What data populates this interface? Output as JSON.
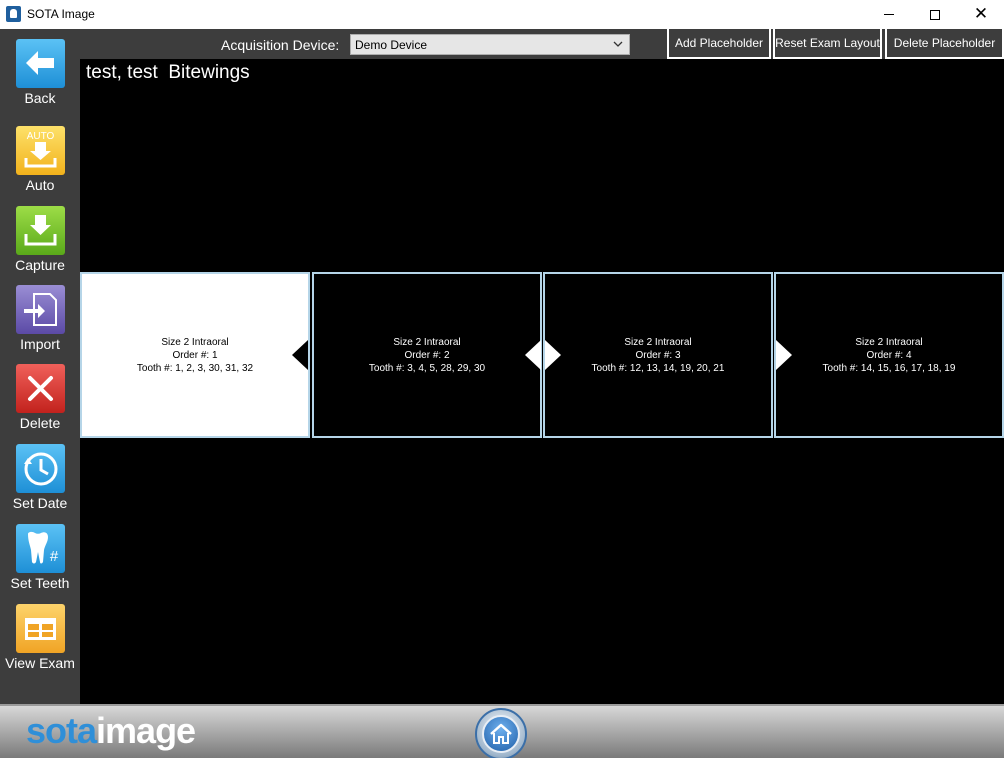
{
  "window": {
    "title": "SOTA Image",
    "icon": "sota-tooth-icon"
  },
  "sidebar": {
    "items": [
      {
        "label": "Back",
        "icon": "back-arrow-icon"
      },
      {
        "label": "Auto",
        "icon": "auto-download-icon",
        "badge": "AUTO"
      },
      {
        "label": "Capture",
        "icon": "capture-download-icon"
      },
      {
        "label": "Import",
        "icon": "import-icon"
      },
      {
        "label": "Delete",
        "icon": "delete-x-icon"
      },
      {
        "label": "Set Date",
        "icon": "clock-icon"
      },
      {
        "label": "Set Teeth",
        "icon": "tooth-number-icon",
        "badge": "#"
      },
      {
        "label": "View Exam",
        "icon": "view-exam-grid-icon"
      }
    ]
  },
  "toolbar": {
    "acquisition_label": "Acquisition Device:",
    "acquisition_value": "Demo Device",
    "add_placeholder": "Add Placeholder",
    "reset_exam_layout": "Reset Exam Layout",
    "delete_placeholder": "Delete Placeholder"
  },
  "exam": {
    "title": "test, test  Bitewings",
    "slots": [
      {
        "type": "Size 2 Intraoral",
        "order": "Order #: 1",
        "teeth": "Tooth #: 1, 2, 3, 30, 31, 32",
        "selected": true
      },
      {
        "type": "Size 2 Intraoral",
        "order": "Order #: 2",
        "teeth": "Tooth #: 3, 4, 5, 28, 29, 30",
        "selected": false
      },
      {
        "type": "Size 2 Intraoral",
        "order": "Order #: 3",
        "teeth": "Tooth #: 12, 13, 14, 19, 20, 21",
        "selected": false
      },
      {
        "type": "Size 2 Intraoral",
        "order": "Order #: 4",
        "teeth": "Tooth #: 14, 15, 16, 17, 18, 19",
        "selected": false
      }
    ]
  },
  "footer": {
    "logo_part1": "sota",
    "logo_part2": "image",
    "home_icon": "home-icon"
  },
  "colors": {
    "sidebar_bg": "#3d3d3d",
    "main_bg": "#000000",
    "slot_border": "#b5d5e8",
    "logo_blue": "#2f8fd8"
  }
}
